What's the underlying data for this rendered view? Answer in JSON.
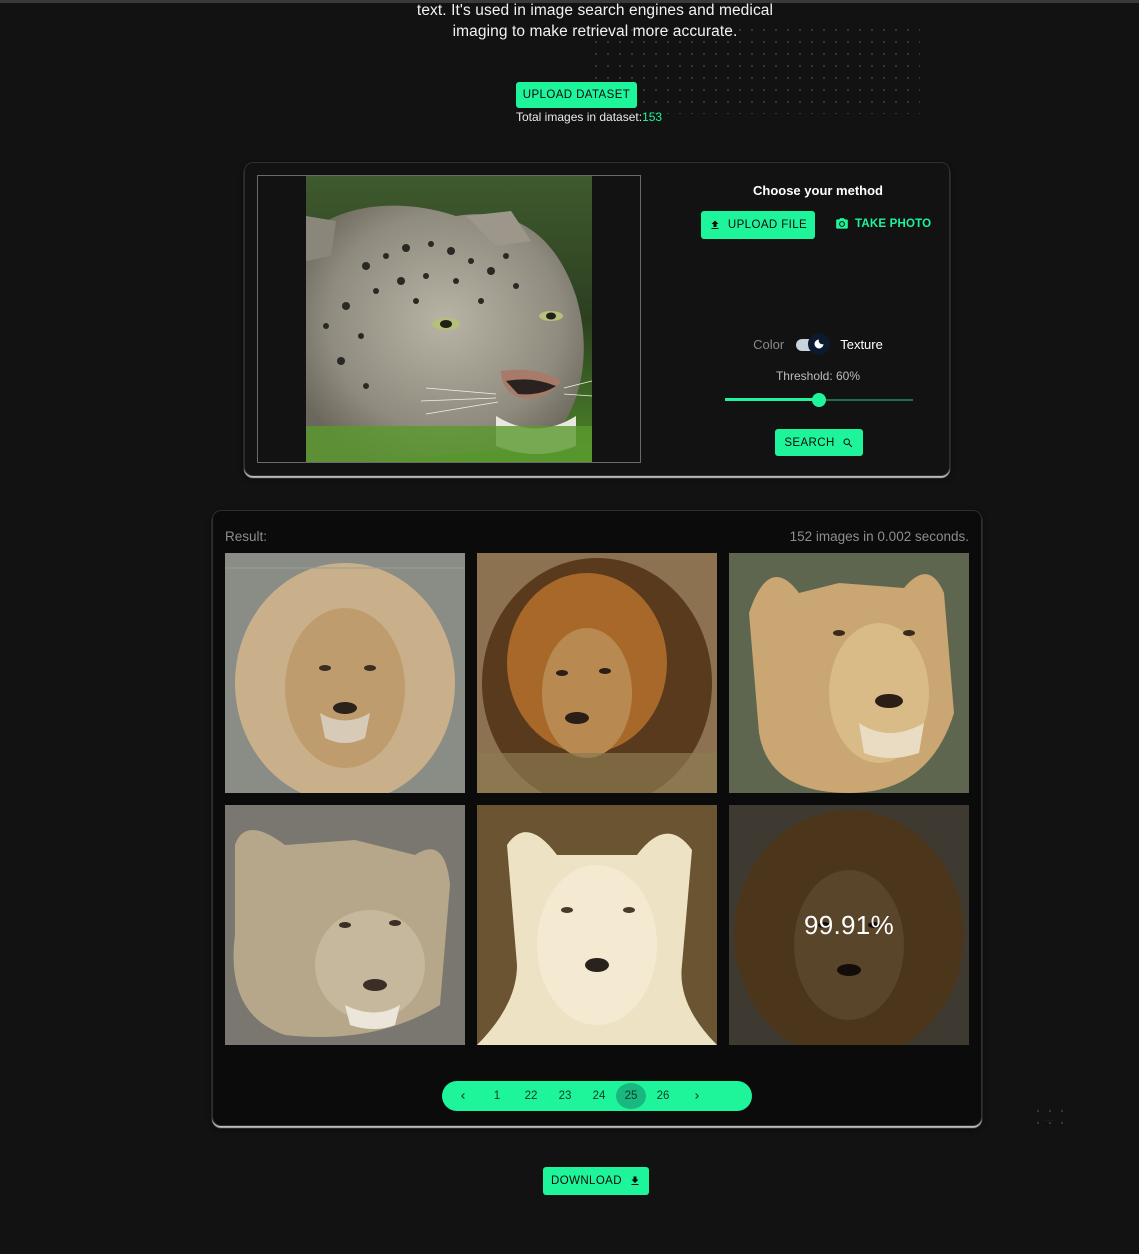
{
  "intro": {
    "line1": "text. It's used in image search engines and medical",
    "line2": "imaging to make retrieval more accurate."
  },
  "dataset": {
    "upload_label": "UPLOAD DATASET",
    "count_label": "Total images in dataset:",
    "count_value": "153"
  },
  "query": {
    "method_title": "Choose your method",
    "upload_file_label": "UPLOAD FILE",
    "take_photo_label": "TAKE PHOTO",
    "toggle_left": "Color",
    "toggle_right": "Texture",
    "toggle_selected": "Texture",
    "threshold_label": "Threshold: 60%",
    "threshold_value": 0.5,
    "search_label": "SEARCH",
    "preview_subject": "snow leopard"
  },
  "result": {
    "label": "Result:",
    "stats": "152 images in 0.002 seconds.",
    "images": [
      {
        "subject": "lion with pale mane"
      },
      {
        "subject": "lion with dark mane"
      },
      {
        "subject": "lioness"
      },
      {
        "subject": "lion cub"
      },
      {
        "subject": "white lioness"
      },
      {
        "subject": "lion",
        "hover_similarity": "99.91%"
      }
    ]
  },
  "pagination": {
    "prev_icon": "chevron-left-icon",
    "pages": [
      "1",
      "...",
      "22",
      "23",
      "24",
      "25",
      "26"
    ],
    "active": "25",
    "next_icon": "chevron-right-icon"
  },
  "download": {
    "label": "DOWNLOAD"
  },
  "colors": {
    "accent": "#1ef59b",
    "background": "#121212",
    "result_bg": "#0b0b0b"
  }
}
